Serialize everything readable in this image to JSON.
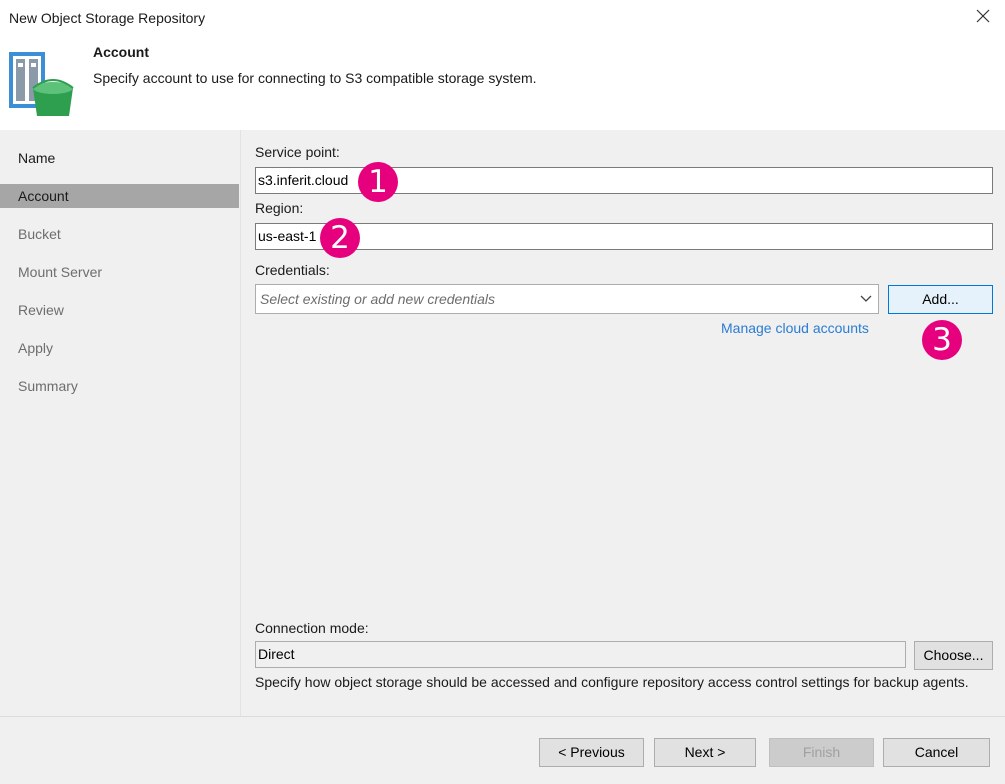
{
  "window": {
    "title": "New Object Storage Repository"
  },
  "header": {
    "title": "Account",
    "subtitle": "Specify account to use for connecting to S3 compatible storage system."
  },
  "sidebar": {
    "items": [
      {
        "label": "Name"
      },
      {
        "label": "Account"
      },
      {
        "label": "Bucket"
      },
      {
        "label": "Mount Server"
      },
      {
        "label": "Review"
      },
      {
        "label": "Apply"
      },
      {
        "label": "Summary"
      }
    ]
  },
  "form": {
    "service_point": {
      "label": "Service point:",
      "value": "s3.inferit.cloud"
    },
    "region": {
      "label": "Region:",
      "value": "us-east-1"
    },
    "credentials": {
      "label": "Credentials:",
      "placeholder": "Select existing or add new credentials",
      "add_button": "Add...",
      "manage_link": "Manage cloud accounts"
    },
    "connection_mode": {
      "label": "Connection mode:",
      "value": "Direct",
      "choose_button": "Choose...",
      "description": "Specify how object storage should be accessed and configure repository access control settings for backup agents."
    }
  },
  "badges": [
    "1",
    "2",
    "3"
  ],
  "footer": {
    "previous": "< Previous",
    "next": "Next >",
    "finish": "Finish",
    "cancel": "Cancel"
  },
  "colors": {
    "badge": "#e6007e",
    "link": "#2b7cd3",
    "active_step": "#a6a6a6",
    "logo_green": "#2e9e4f",
    "logo_blue": "#3b8fd6"
  }
}
